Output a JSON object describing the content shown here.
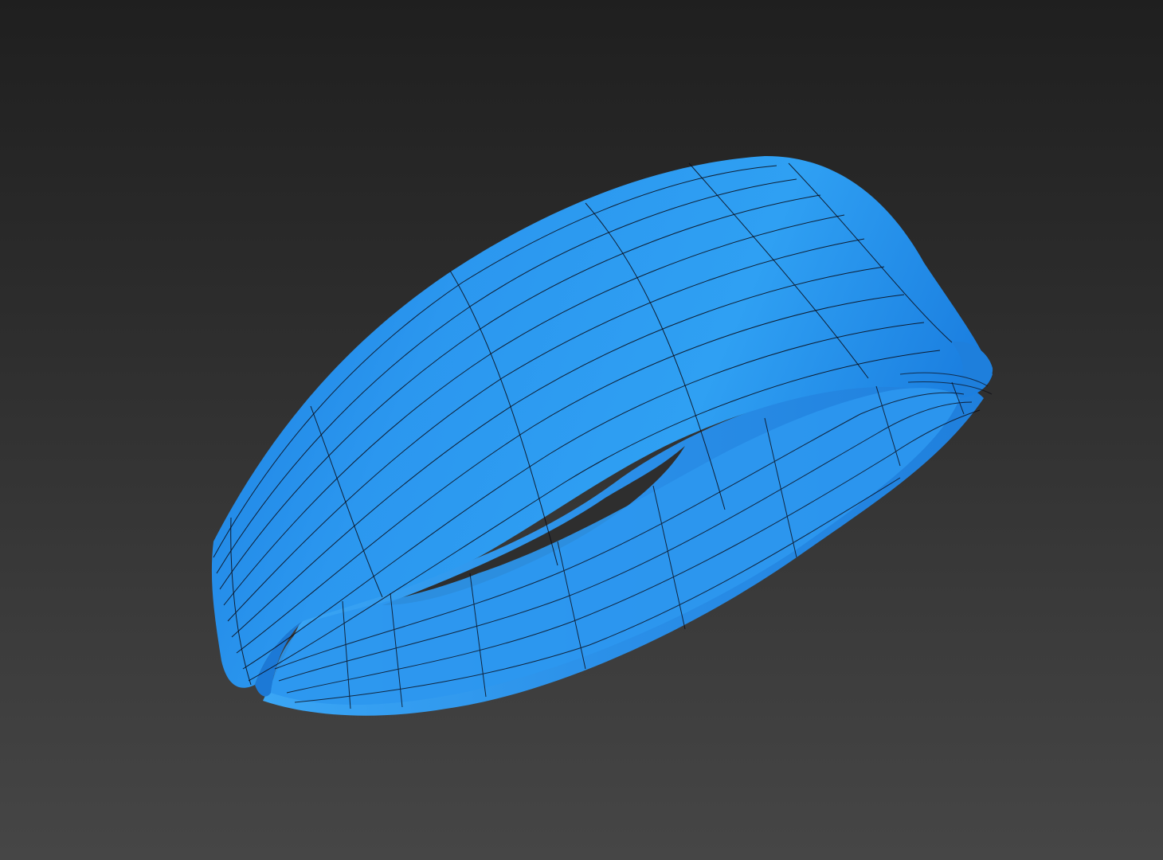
{
  "scene": {
    "object": "headband-mesh",
    "render_mode": "shaded-with-wireframe",
    "colors": {
      "background_top": "#1f1f1f",
      "background_bottom": "#464646",
      "band_light": "#2f9df0",
      "band_mid": "#1e86e6",
      "band_dark": "#1466c4",
      "inner_surface": "#2a93ee",
      "wire": "#0a0a14"
    }
  }
}
